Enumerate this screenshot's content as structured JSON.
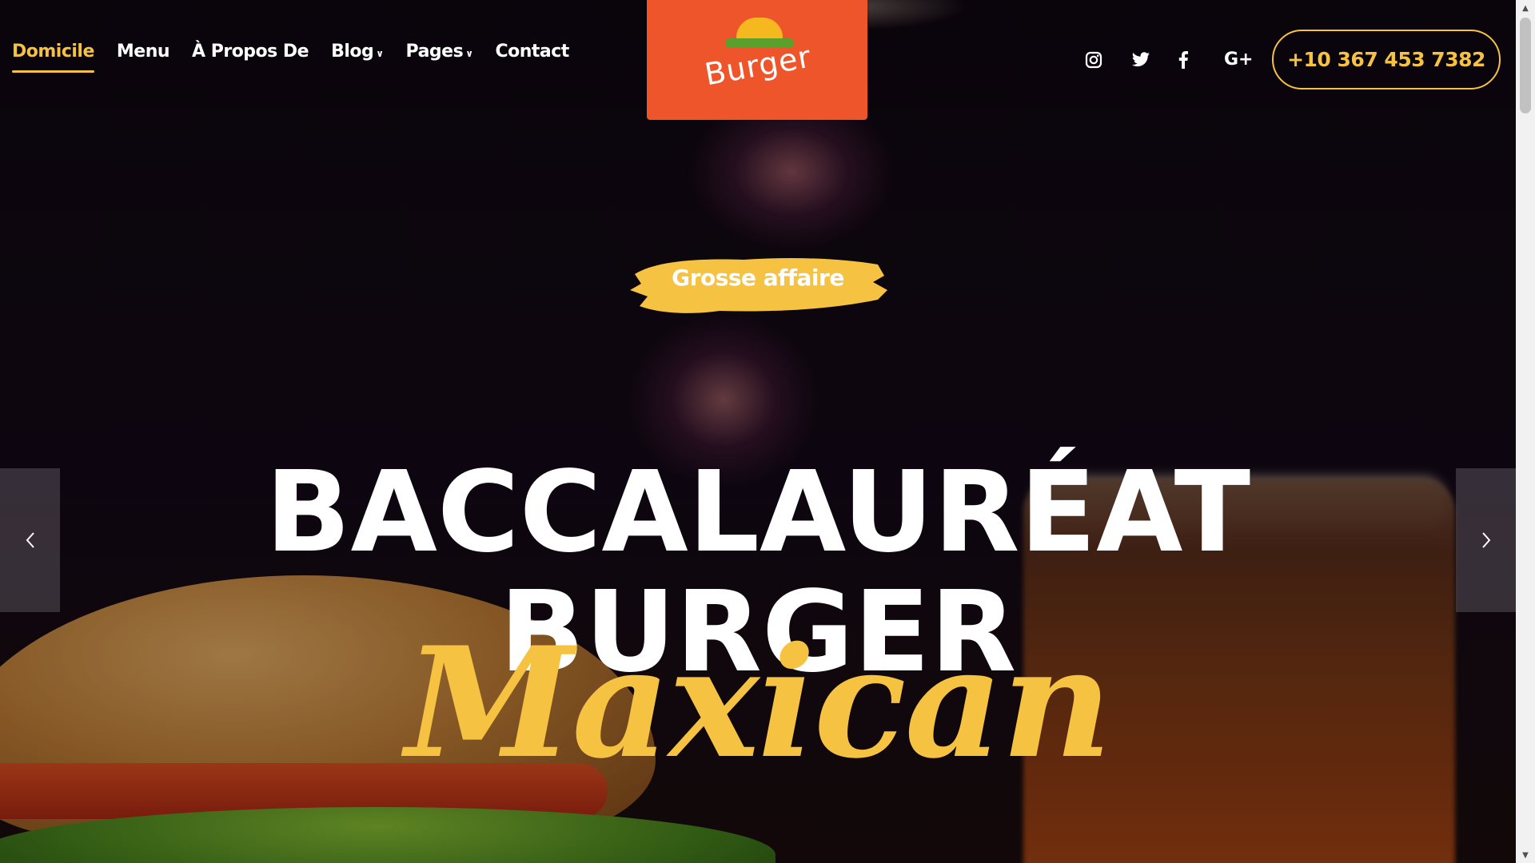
{
  "nav": {
    "items": [
      {
        "label": "Domicile",
        "active": true
      },
      {
        "label": "Menu"
      },
      {
        "label": "À Propos De"
      },
      {
        "label": "Blog",
        "dropdown": true
      },
      {
        "label": "Pages",
        "dropdown": true
      },
      {
        "label": "Contact"
      }
    ]
  },
  "logo": {
    "text": "Burger",
    "bg_color": "#ef552b"
  },
  "social": [
    "instagram-icon",
    "twitter-icon",
    "facebook-icon",
    "google-plus-icon"
  ],
  "social_gplus_label": "G+",
  "phone": "+10 367 453 7382",
  "hero": {
    "tag": "Grosse affaire",
    "title_line1": "BACCALAURÉAT",
    "title_line2": "BURGER",
    "script": "Maxican"
  },
  "colors": {
    "accent": "#f5c242",
    "logo_bg": "#ef552b",
    "text": "#ffffff"
  }
}
